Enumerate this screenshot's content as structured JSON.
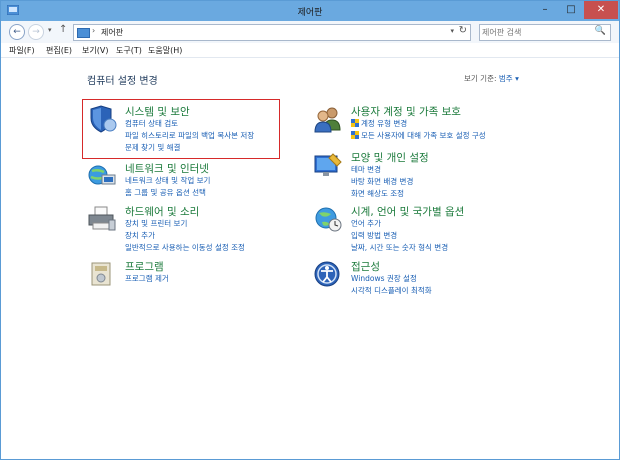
{
  "window": {
    "title": "제어판"
  },
  "nav": {
    "back": "←",
    "forward": "→",
    "dropdown": "▾",
    "up": "↑"
  },
  "address": {
    "separator": "›",
    "crumb": "제어판",
    "dropdown": "▾",
    "refresh": "↻"
  },
  "search": {
    "placeholder": "제어판 검색",
    "icon": "🔍"
  },
  "menu": [
    "파일(F)",
    "편집(E)",
    "보기(V)",
    "도구(T)",
    "도움말(H)"
  ],
  "page": {
    "title": "컴퓨터 설정 변경",
    "view_by_label": "보기 기준:",
    "view_by_value": "범주 ▾"
  },
  "categories": [
    {
      "head": "시스템 및 보안",
      "links": [
        "컴퓨터 상태 검토",
        "파일 히스토리로 파일의 백업 복사본 저장",
        "문제 찾기 및 해결"
      ]
    },
    {
      "head": "네트워크 및 인터넷",
      "links": [
        "네트워크 상태 및 작업 보기",
        "홈 그룹 및 공유 옵션 선택"
      ]
    },
    {
      "head": "하드웨어 및 소리",
      "links": [
        "장치 및 프린터 보기",
        "장치 추가",
        "일반적으로 사용하는 이동성 설정 조정"
      ]
    },
    {
      "head": "프로그램",
      "links": [
        "프로그램 제거"
      ]
    },
    {
      "head": "사용자 계정 및 가족 보호",
      "links": [
        "계정 유형 변경",
        "모든 사용자에 대해 가족 보호 설정 구성"
      ]
    },
    {
      "head": "모양 및 개인 설정",
      "links": [
        "테마 변경",
        "바탕 화면 배경 변경",
        "화면 해상도 조정"
      ]
    },
    {
      "head": "시계, 언어 및 국가별 옵션",
      "links": [
        "언어 추가",
        "입력 방법 변경",
        "날짜, 시간 또는 숫자 형식 변경"
      ]
    },
    {
      "head": "접근성",
      "links": [
        "Windows 권장 설정",
        "시각적 디스플레이 최적화"
      ]
    }
  ],
  "window_buttons": {
    "minimize": "–",
    "maximize": "□",
    "close": "✕"
  },
  "colors": {
    "title_bar": "#6aa9e0",
    "link": "#1a5fb4",
    "category_heading": "#1b7a3b",
    "highlight": "#d62a2a"
  }
}
